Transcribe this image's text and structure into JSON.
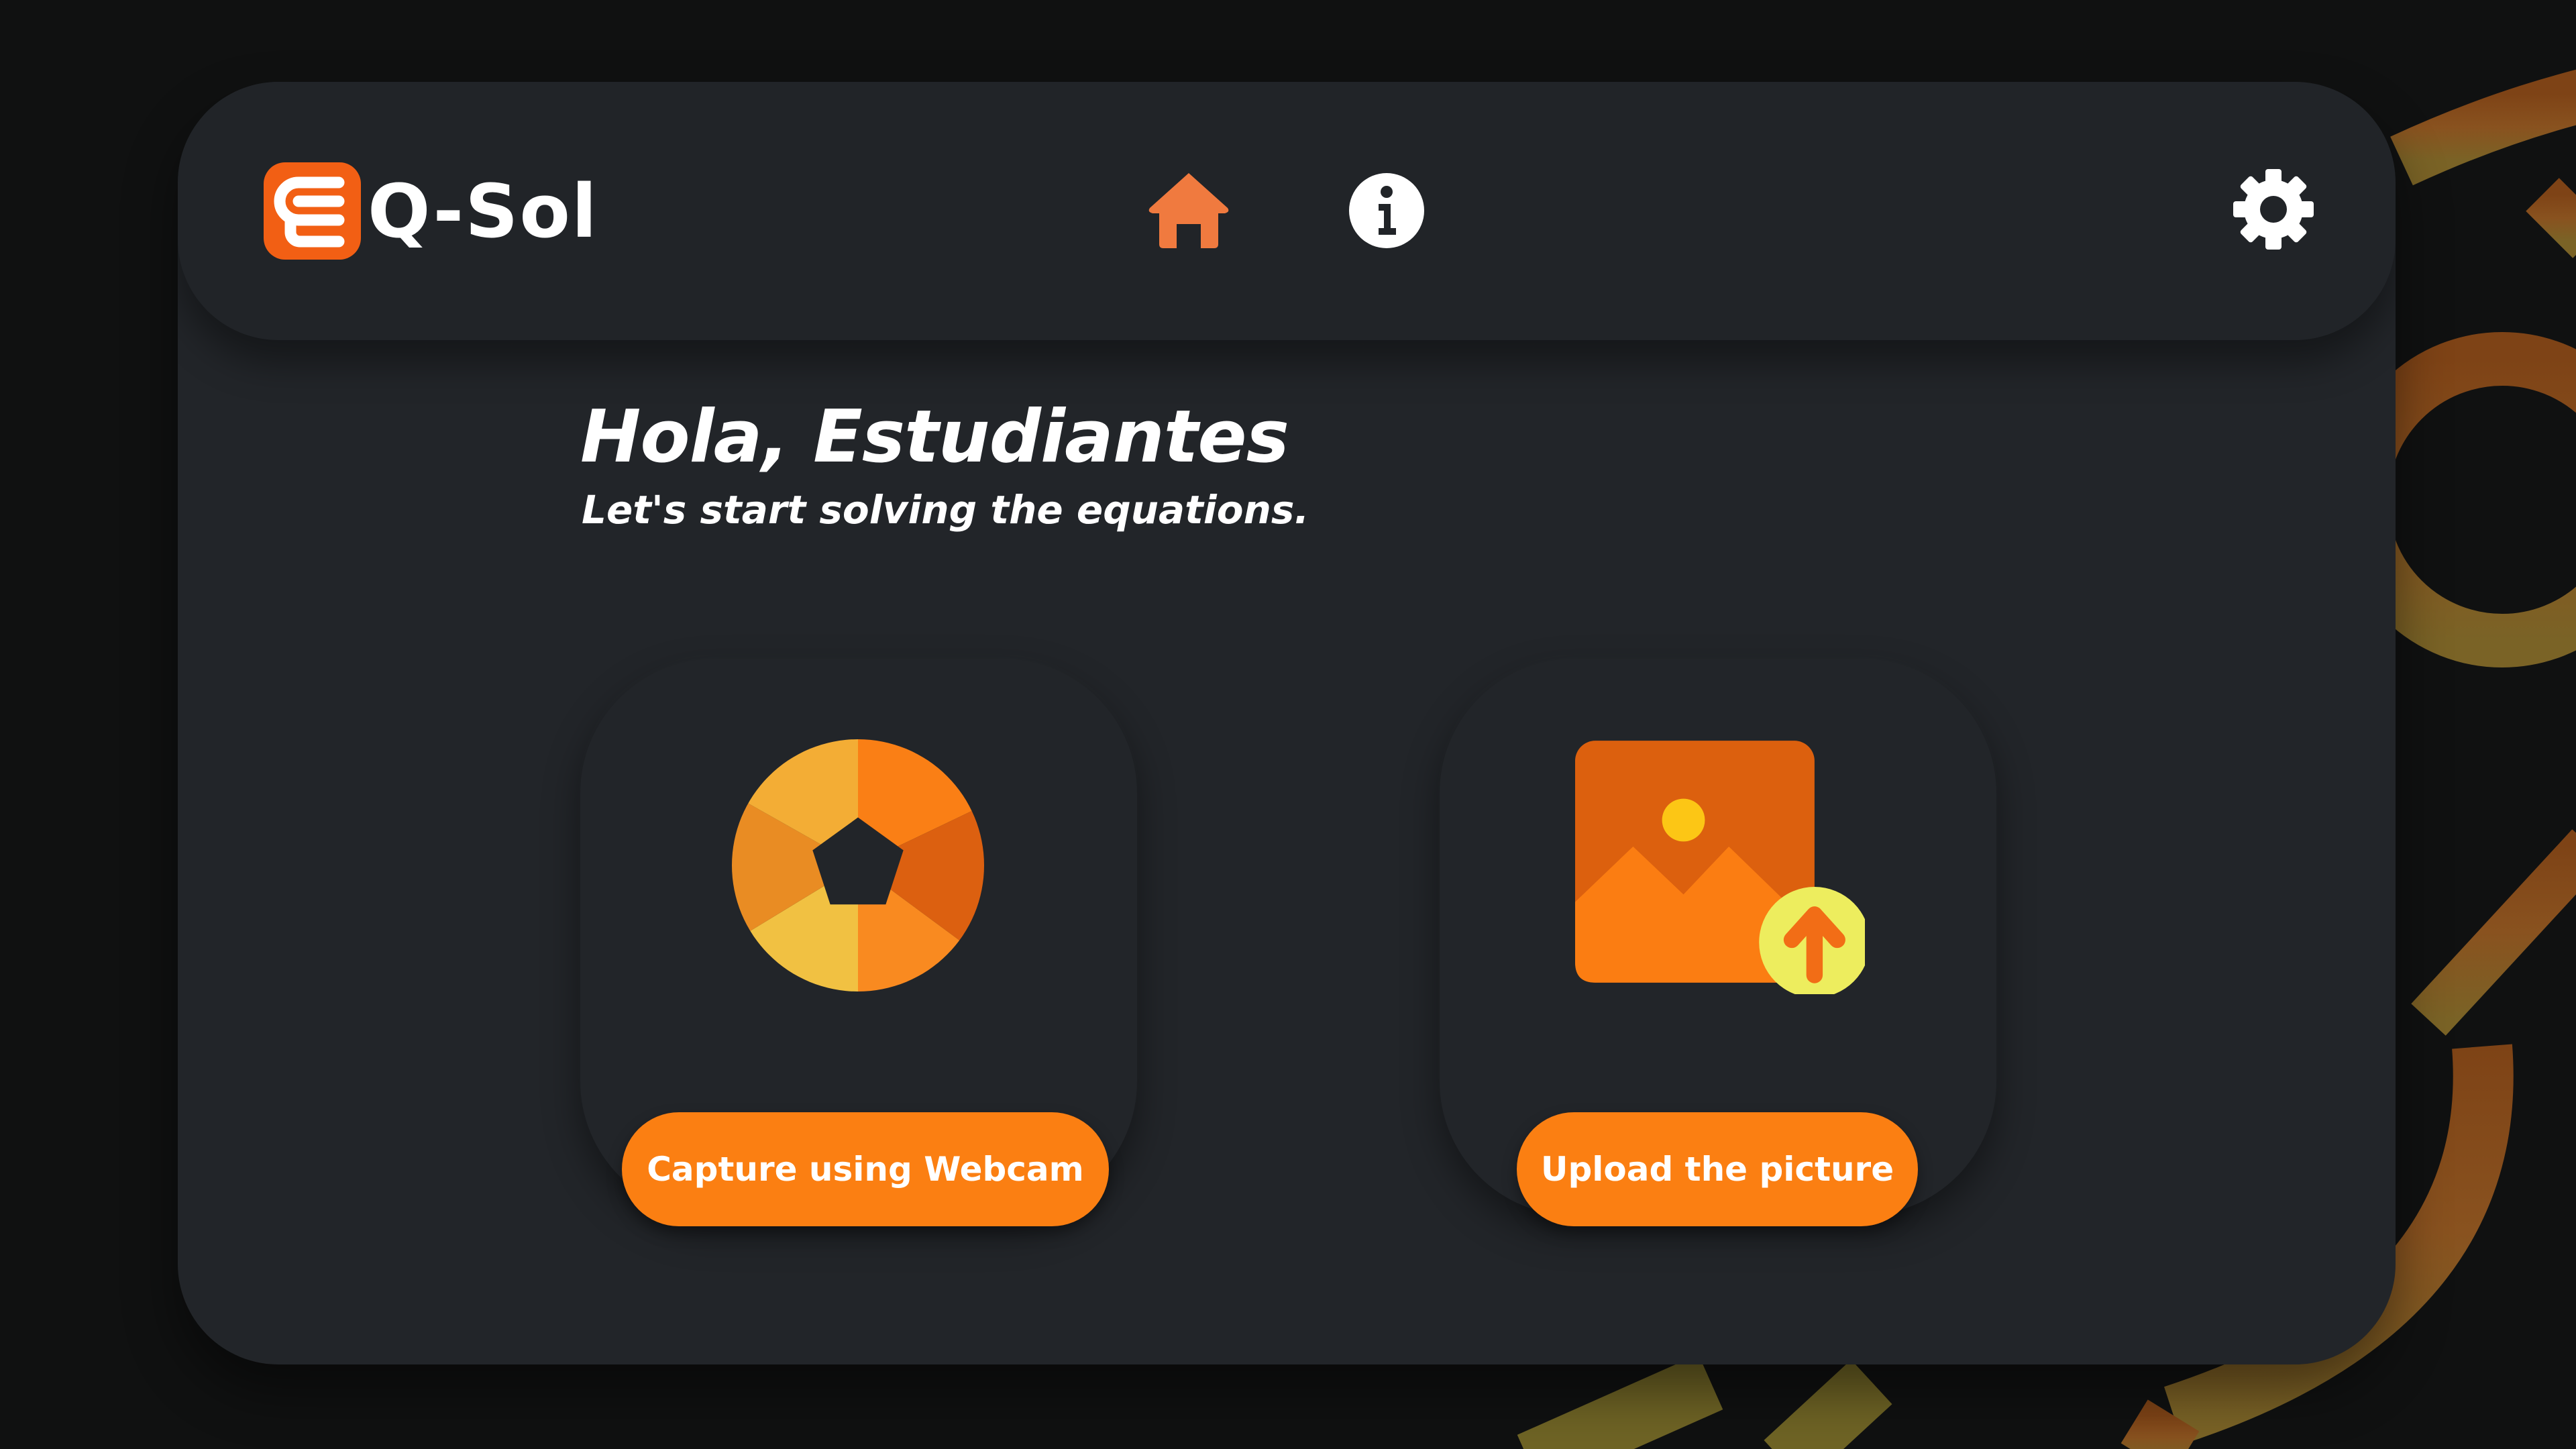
{
  "app": {
    "name": "Q-Sol",
    "logo_icon": "eq-logo-icon"
  },
  "navbar": {
    "items": [
      {
        "icon": "home-icon",
        "active": true,
        "color": "#f07a3f"
      },
      {
        "icon": "info-icon",
        "active": false,
        "color": "#ffffff"
      }
    ],
    "settings_icon": "gear-icon"
  },
  "hero": {
    "greeting": "Hola, Estudiantes",
    "subtitle": "Let's start solving the equations."
  },
  "actions": [
    {
      "icon": "camera-shutter-icon",
      "label": "Capture using Webcam"
    },
    {
      "icon": "image-upload-icon",
      "label": "Upload the picture"
    }
  ],
  "colors": {
    "accent": "#fb7f12",
    "panel": "#222529",
    "background": "#101111",
    "text": "#ffffff"
  }
}
